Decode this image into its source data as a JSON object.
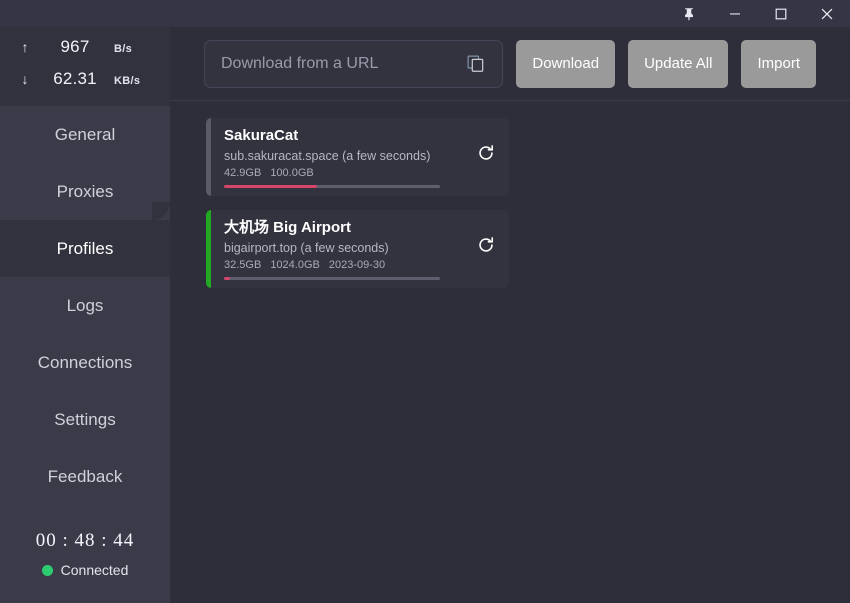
{
  "titlebar": {
    "pin_label": "pin-window",
    "minimize_label": "minimize",
    "maximize_label": "maximize",
    "close_label": "close"
  },
  "sidebar": {
    "speed": {
      "upload": {
        "arrow": "↑",
        "value": "967",
        "unit": "B/s"
      },
      "download": {
        "arrow": "↓",
        "value": "62.31",
        "unit": "KB/s"
      }
    },
    "items": [
      {
        "label": "General",
        "active": false
      },
      {
        "label": "Proxies",
        "active": false
      },
      {
        "label": "Profiles",
        "active": true
      },
      {
        "label": "Logs",
        "active": false
      },
      {
        "label": "Connections",
        "active": false
      },
      {
        "label": "Settings",
        "active": false
      },
      {
        "label": "Feedback",
        "active": false
      }
    ],
    "status": {
      "timer": "00 : 48 : 44",
      "connection_label": "Connected",
      "connection_color": "#2ecc71"
    }
  },
  "toolbar": {
    "url_value": "",
    "url_placeholder": "Download from a URL",
    "copy_icon": "copy-icon",
    "download_label": "Download",
    "update_all_label": "Update All",
    "import_label": "Import"
  },
  "profiles": [
    {
      "title": "SakuraCat",
      "subtitle": "sub.sakuracat.space (a few seconds)",
      "used": "42.9GB",
      "total": "100.0GB",
      "expiry": "",
      "progress": 43,
      "selected": false,
      "accent": "#5a5a68"
    },
    {
      "title": "大机场 Big Airport",
      "subtitle": "bigairport.top (a few seconds)",
      "used": "32.5GB",
      "total": "1024.0GB",
      "expiry": "2023-09-30",
      "progress": 3,
      "selected": true,
      "accent": "#22a822"
    }
  ]
}
